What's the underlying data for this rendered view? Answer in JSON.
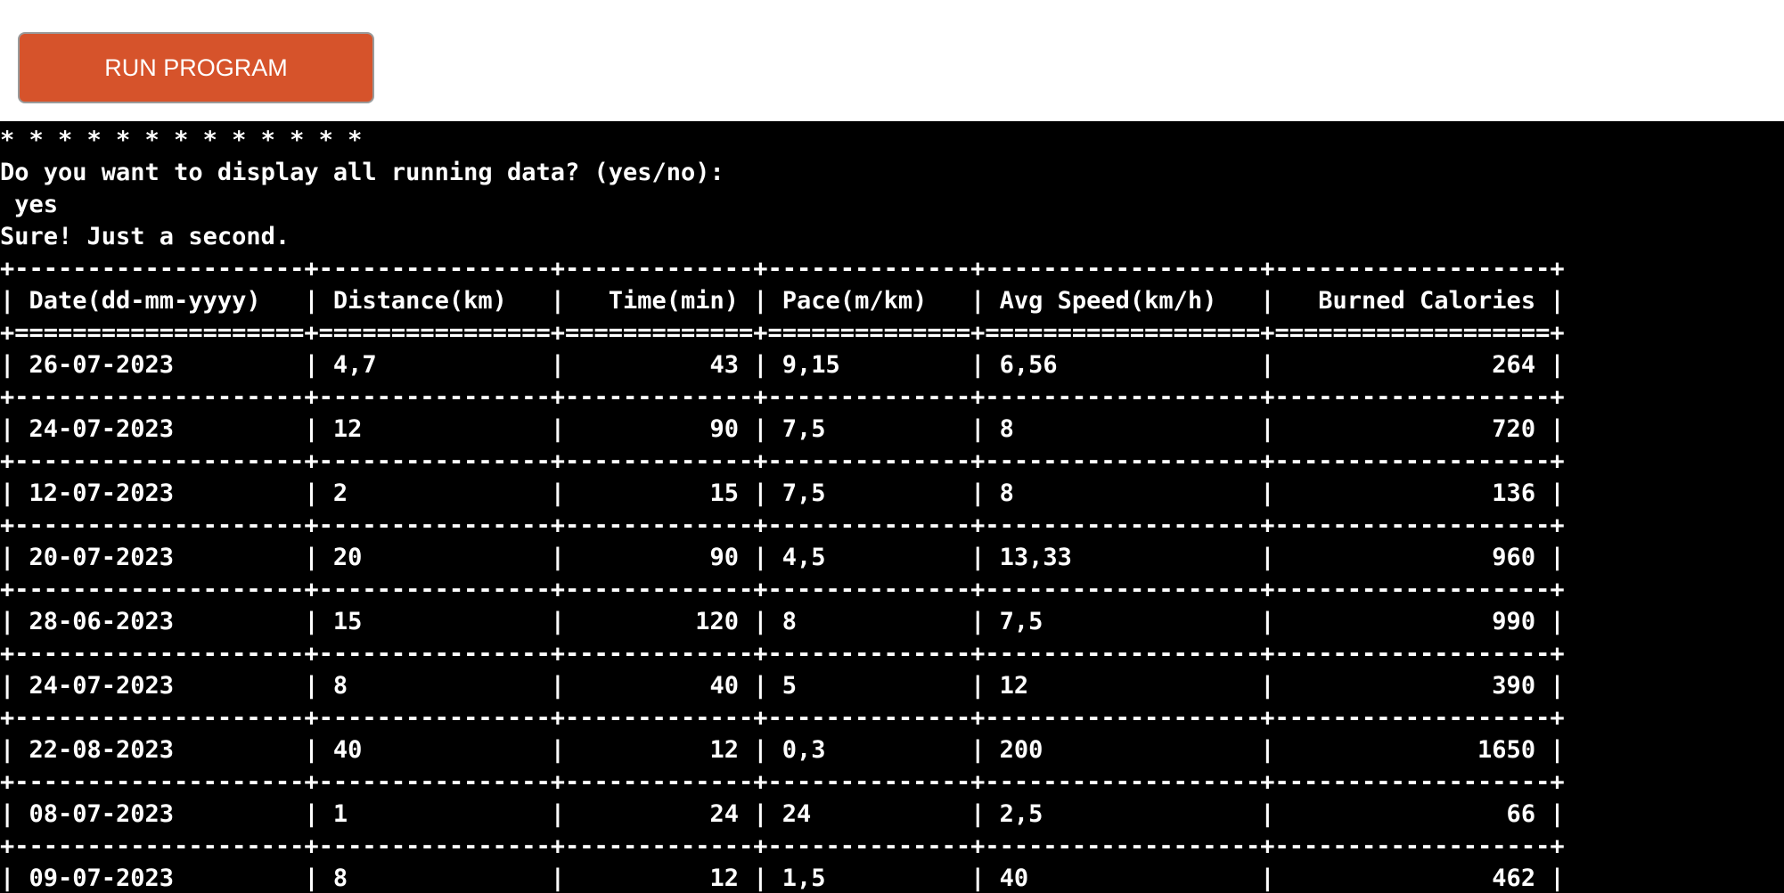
{
  "toolbar": {
    "run_label": "RUN PROGRAM"
  },
  "colors": {
    "button_bg": "#d6532b",
    "terminal_bg": "#000000",
    "terminal_fg": "#ffffff"
  },
  "terminal": {
    "stars": "* * * * * * * * * * * * *",
    "prompt": "Do you want to display all running data? (yes/no):",
    "answer": " yes",
    "reply": "Sure! Just a second.",
    "table": {
      "columns": [
        "Date(dd-mm-yyyy)",
        "Distance(km)",
        "Time(min)",
        "Pace(m/km)",
        "Avg Speed(km/h)",
        "Burned Calories"
      ],
      "rows": [
        [
          "26-07-2023",
          "4,7",
          "43",
          "9,15",
          "6,56",
          "264"
        ],
        [
          "24-07-2023",
          "12",
          "90",
          "7,5",
          "8",
          "720"
        ],
        [
          "12-07-2023",
          "2",
          "15",
          "7,5",
          "8",
          "136"
        ],
        [
          "20-07-2023",
          "20",
          "90",
          "4,5",
          "13,33",
          "960"
        ],
        [
          "28-06-2023",
          "15",
          "120",
          "8",
          "7,5",
          "990"
        ],
        [
          "24-07-2023",
          "8",
          "40",
          "5",
          "12",
          "390"
        ],
        [
          "22-08-2023",
          "40",
          "12",
          "0,3",
          "200",
          "1650"
        ],
        [
          "08-07-2023",
          "1",
          "24",
          "24",
          "2,5",
          "66"
        ],
        [
          "09-07-2023",
          "8",
          "12",
          "1,5",
          "40",
          "462"
        ]
      ]
    }
  }
}
